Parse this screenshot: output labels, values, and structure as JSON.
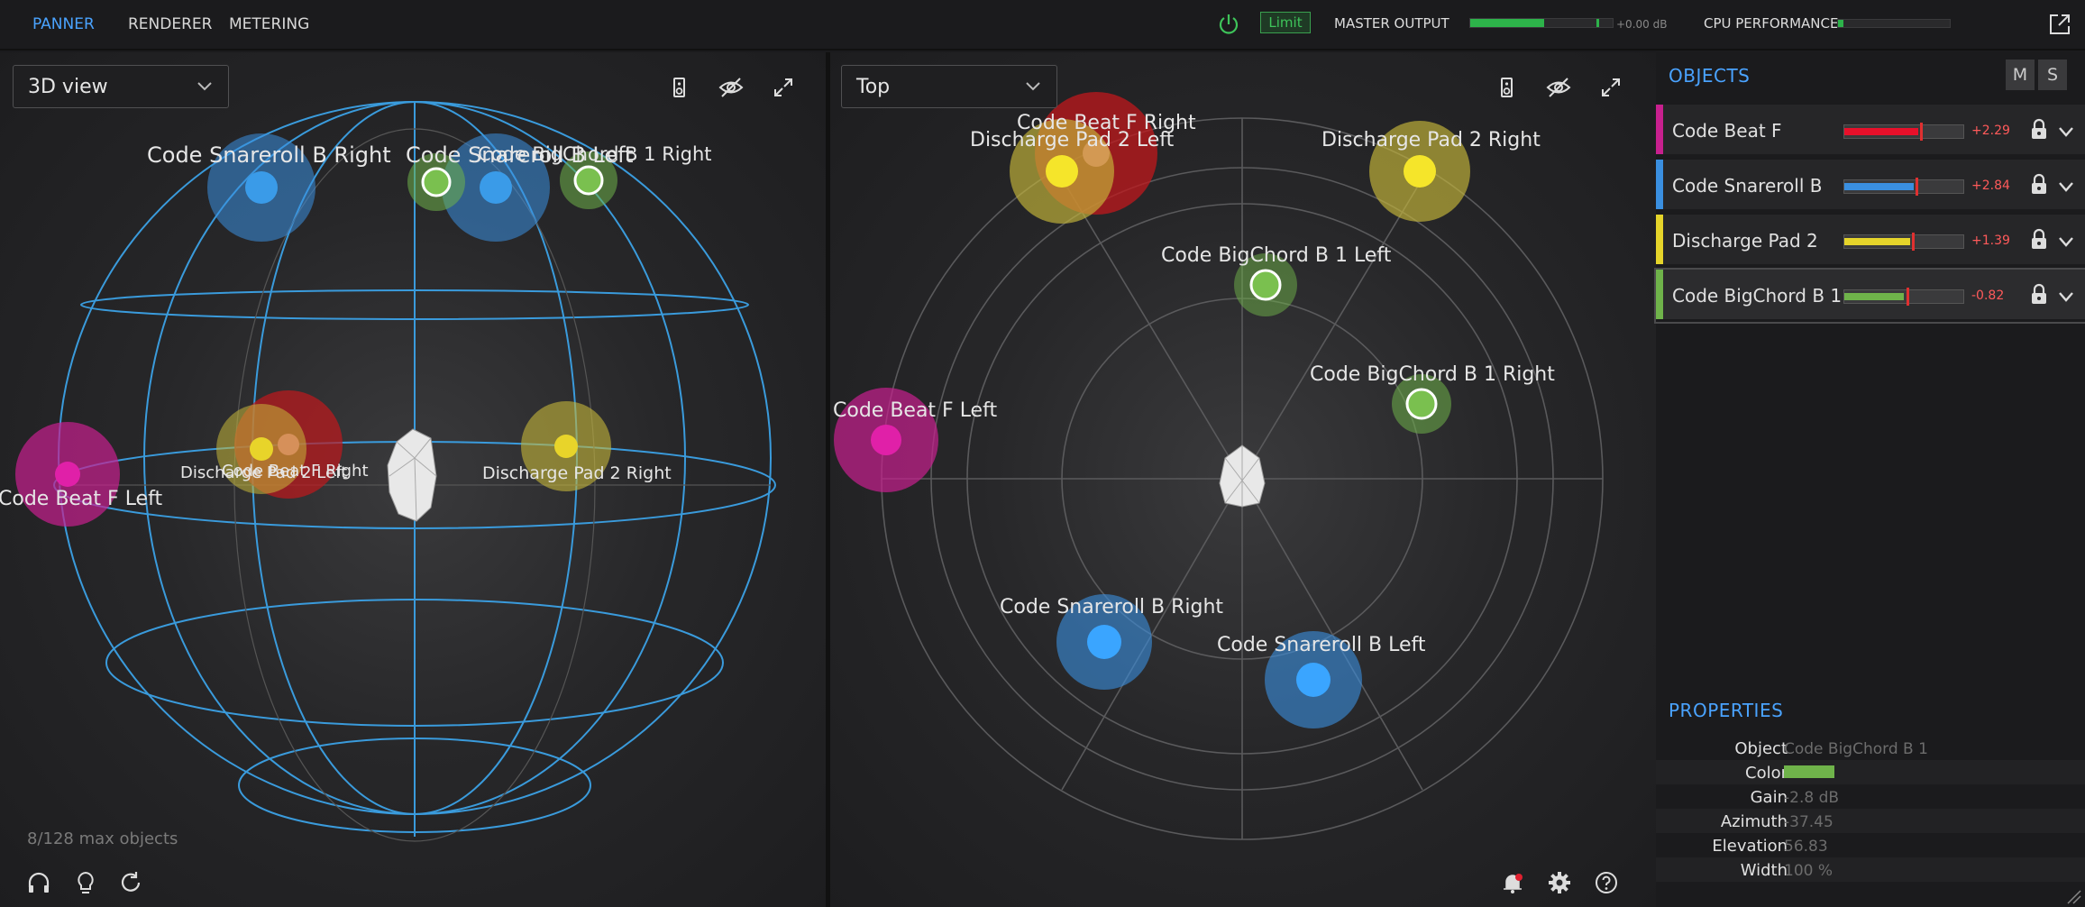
{
  "tabs": [
    {
      "label": "PANNER",
      "active": true
    },
    {
      "label": "RENDERER",
      "active": false
    },
    {
      "label": "METERING",
      "active": false
    }
  ],
  "topbar": {
    "limit_label": "Limit",
    "master_label": "MASTER OUTPUT",
    "master_level": 0.52,
    "master_db": "+0.00 dB",
    "cpu_label": "CPU PERFORMANCE",
    "cpu_level": 0.05,
    "accent": "#4aa3ff",
    "limit_color": "#3ec45a"
  },
  "left_view": {
    "dropdown_value": "3D view",
    "max_objects": "8/128 max objects"
  },
  "right_view": {
    "dropdown_value": "Top"
  },
  "sphere_labels": {
    "snare_right": "Code Snareroll B Right",
    "snare_left": "Code Snareroll B Left",
    "bigchord_left": "Code BigChord B 1 Left",
    "bigchord_right": "Code BigChord B 1 Right",
    "beat_left": "Code Beat F Left",
    "beat_right": "Code Beat F Right",
    "pad_left": "Discharge Pad 2 Left",
    "pad_right": "Discharge Pad 2 Right"
  },
  "objects_panel": {
    "title": "OBJECTS",
    "m_label": "M",
    "s_label": "S",
    "items": [
      {
        "name": "Code Beat F",
        "color": "#c8208e",
        "meter_color": "#e8102a",
        "level": 0.62,
        "gain": "+2.29",
        "selected": false
      },
      {
        "name": "Code Snareroll B",
        "color": "#3a8fe0",
        "meter_color": "#3a8fe0",
        "level": 0.58,
        "gain": "+2.84",
        "selected": false
      },
      {
        "name": "Discharge Pad 2",
        "color": "#e5d42a",
        "meter_color": "#e5d42a",
        "level": 0.55,
        "gain": "+1.39",
        "selected": false
      },
      {
        "name": "Code BigChord B 1",
        "color": "#6fb34a",
        "meter_color": "#6fb34a",
        "level": 0.5,
        "gain": "-0.82",
        "selected": true
      }
    ]
  },
  "properties": {
    "title": "PROPERTIES",
    "object_key": "Object",
    "object_val": "Code BigChord B 1",
    "color_key": "Color",
    "color_val": "#6fb34a",
    "gain_key": "Gain",
    "gain_val": "-2.8 dB",
    "azimuth_key": "Azimuth",
    "azimuth_val": "-37.45",
    "elevation_key": "Elevation",
    "elevation_val": "56.83",
    "width_key": "Width",
    "width_val": "100 %"
  }
}
